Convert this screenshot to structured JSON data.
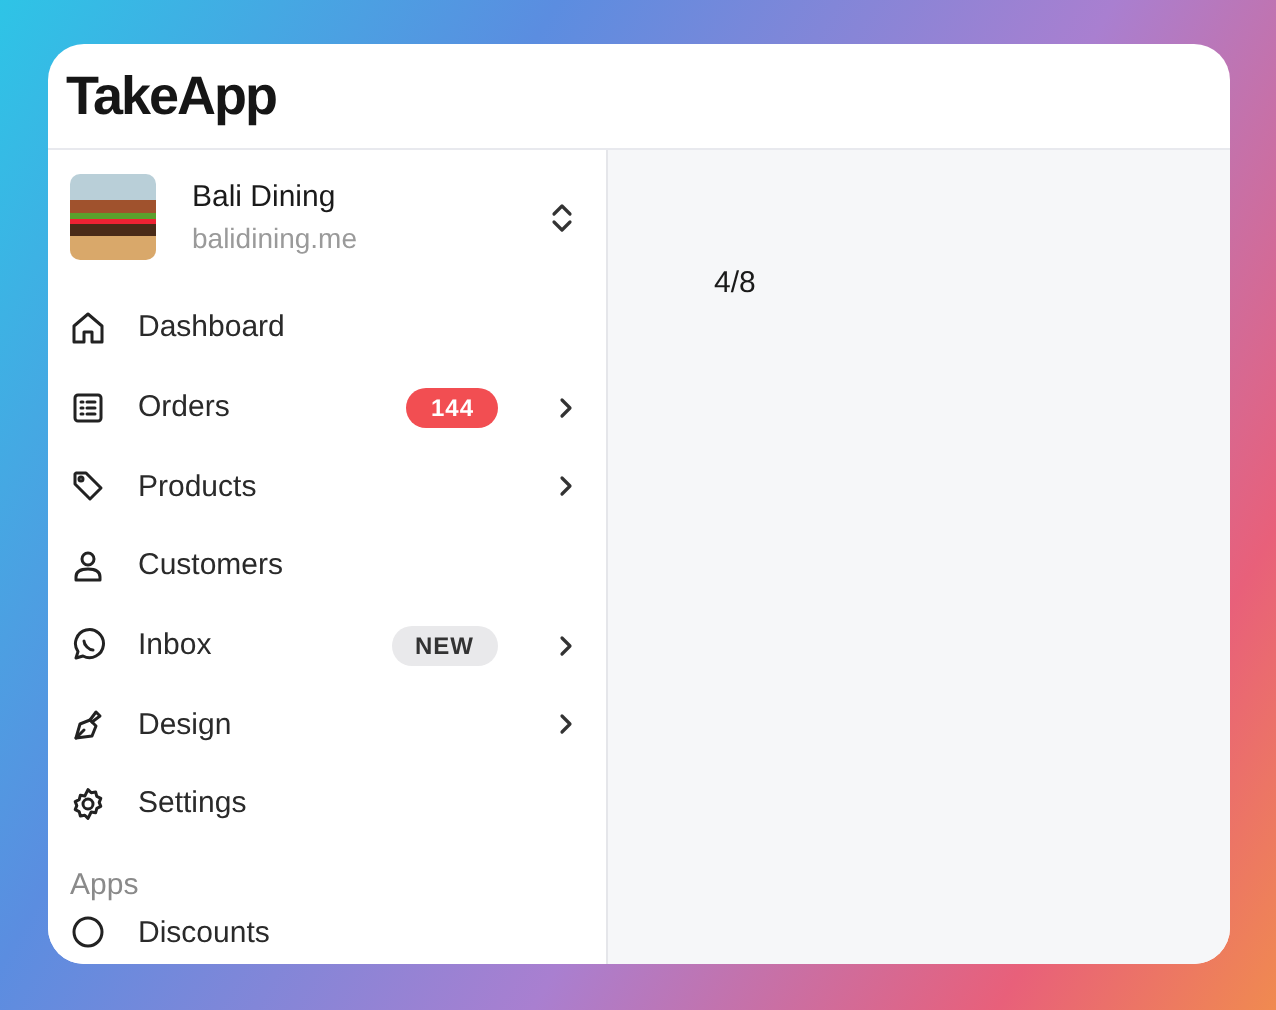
{
  "header": {
    "logo": "TakeApp"
  },
  "store": {
    "name": "Bali Dining",
    "domain": "balidining.me"
  },
  "nav": [
    {
      "label": "Dashboard",
      "expandable": false
    },
    {
      "label": "Orders",
      "expandable": true,
      "badge": {
        "text": "144",
        "kind": "count"
      }
    },
    {
      "label": "Products",
      "expandable": true
    },
    {
      "label": "Customers",
      "expandable": false
    },
    {
      "label": "Inbox",
      "expandable": true,
      "badge": {
        "text": "NEW",
        "kind": "tag"
      }
    },
    {
      "label": "Design",
      "expandable": true
    },
    {
      "label": "Settings",
      "expandable": false
    }
  ],
  "apps": {
    "heading": "Apps",
    "items": [
      {
        "label": "Discounts"
      }
    ]
  },
  "main": {
    "text": "4/8"
  }
}
